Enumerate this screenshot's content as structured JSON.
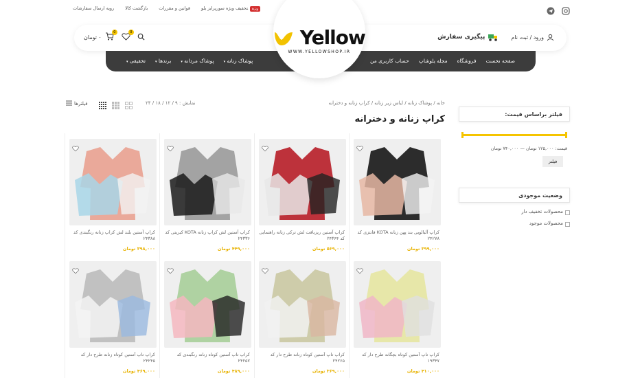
{
  "topbar": {
    "links": [
      "رویه ارسال سفارشات",
      "بازگشت کالا",
      "قوانین و مقررات",
      "تخفیف ویژه سورپرایز یلو"
    ],
    "badge": "ویژه",
    "social": [
      "telegram-icon",
      "instagram-icon"
    ]
  },
  "header": {
    "login": "ورود / ثبت نام",
    "track_order": "پیگیری سفارش",
    "cart_count": "0",
    "cart_total": "۰ تومان",
    "wishlist_count": "0"
  },
  "logo": {
    "word": "Yellow",
    "site": "WWW.YELLOWSHOP.IR",
    "tm": "TM"
  },
  "nav": {
    "right": [
      "صفحه نخست",
      "فروشگاه",
      "مجله یلوشاپ",
      "حساب کاربری من"
    ],
    "left": [
      "پوشاک زنانه",
      "پوشاک مردانه",
      "برندها",
      "تخفیفی"
    ]
  },
  "breadcrumb": "خانه / پوشاک زنانه / لباس زیر زنانه / کراپ زنانه و دخترانه",
  "page_title": "کراپ زنانه و دخترانه",
  "showbar": "نمایش : ۹ / ۱۲ / ۱۸ / ۲۴",
  "filter_button": "فیلترها",
  "sidebar": {
    "price_title": "فیلتر براساس قیمت:",
    "price_range": "قیمت: ۱۲۵,۰۰۰ تومان — ۷۴۰,۰۰۰ تومان",
    "price_min_fraction": 0,
    "price_max_fraction": 1,
    "filter_btn": "فیلتر",
    "stock_title": "وضعیت موجودی",
    "stock_items": [
      "محصولات تخفیف دار",
      "محصولات موجود"
    ]
  },
  "products": [
    {
      "name": "کراپ آلبالویی بند پهن زنانه KOTA فانتزی کد ۲۴۲۷۸",
      "price": "۳۹۹,۰۰۰ تومان",
      "colors": [
        "#1b1b1b",
        "#e6b7a3",
        "#f4f4f4"
      ]
    },
    {
      "name": "کراپ آستین ریزبافت لش ترکی زنانه راهنمایی کد ۲۴۳۶۴",
      "price": "۵۶۹,۰۰۰ تومان",
      "colors": [
        "#b9222b",
        "#e8e8e8",
        "#222"
      ]
    },
    {
      "name": "کراپ آستین لش کراپ زنانه KOTA کبریتی کد ۲۴۳۳۶",
      "price": "۴۴۹,۰۰۰ تومان",
      "colors": [
        "#9c9c9c",
        "#1a1a1a",
        "#e9e9e9"
      ]
    },
    {
      "name": "کراپ آستین بلند لش کراپ زنانه رنگبندی کد ۲۴۳۸۸",
      "price": "۳۹۸,۰۰۰ تومان",
      "colors": [
        "#e9a392",
        "#a8d6e8",
        "#f2f2f2"
      ]
    },
    {
      "name": "کراپ تاپ آستین کوتاه بچگانه طرح دار کد ۱۹۳۴۷",
      "price": "۴۱۰,۰۰۰ تومان",
      "colors": [
        "#e6e6a3",
        "#f0b6c7",
        "#e0e0e0"
      ]
    },
    {
      "name": "کراپ تاپ آستین کوتاه زنانه طرح دار کد ۲۴۲۶۵",
      "price": "۳۶۹,۰۰۰ تومان",
      "colors": [
        "#cbc9a4",
        "#f1f1f1",
        "#d9b6a1"
      ]
    },
    {
      "name": "کراپ تاپ آستین کوتاه زنانه رنگبندی کد ۲۴۲۵۷",
      "price": "۴۸۹,۰۰۰ تومان",
      "colors": [
        "#a9cf9b",
        "#f5b7c0",
        "#222"
      ]
    },
    {
      "name": "کراپ تاپ آستین کوتاه زنانه طرح دار کد ۲۴۲۴۵",
      "price": "۴۶۹,۰۰۰ تومان",
      "colors": [
        "#bdbdbd",
        "#f3f3f3",
        "#9ab9e0"
      ]
    }
  ],
  "colors": {
    "accent": "#f5c400",
    "nav_bg": "#3c3c3c",
    "price": "#e8b200"
  }
}
